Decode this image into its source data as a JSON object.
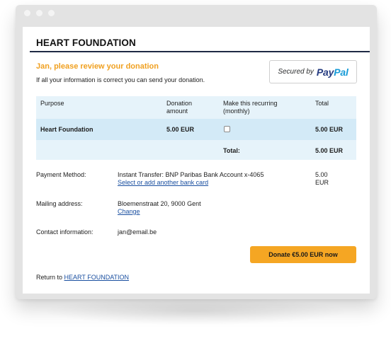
{
  "org_title": "HEART FOUNDATION",
  "greeting": "Jan, please review your donation",
  "subtext": "If all your information is correct you can send your donation.",
  "paypal": {
    "secured_text": "Secured by",
    "logo_part1": "Pay",
    "logo_part2": "Pal"
  },
  "table": {
    "headers": {
      "purpose": "Purpose",
      "amount": [
        "Donation",
        "amount"
      ],
      "recurring": [
        "Make this recurring",
        "(monthly)"
      ],
      "total": "Total"
    },
    "item": {
      "purpose": "Heart Foundation",
      "amount": "5.00 EUR",
      "recurring_checked": false,
      "total": "5.00 EUR"
    },
    "total_row": {
      "label": "Total:",
      "value": "5.00 EUR"
    }
  },
  "payment": {
    "label": "Payment Method:",
    "value": "Instant Transfer: BNP Paribas Bank Account x-4065",
    "link": "Select or add another bank card",
    "amount": "5.00 EUR"
  },
  "mailing": {
    "label": "Mailing address:",
    "value": "Bloemenstraat 20, 9000 Gent",
    "link": "Change"
  },
  "contact": {
    "label": "Contact information:",
    "value": "jan@email.be"
  },
  "donate_button": "Donate €5.00 EUR now",
  "return_line": {
    "prefix": "Return to",
    "link": "HEART FOUNDATION"
  },
  "colors": {
    "accent": "#f0a020",
    "button": "#f5a623",
    "title_rule": "#1f2a44",
    "table_header_bg": "#e6f3fa",
    "table_item_bg": "#d3eaf7",
    "link": "#1a4fa0",
    "paypal_dark": "#253b80",
    "paypal_light": "#179bd7"
  }
}
